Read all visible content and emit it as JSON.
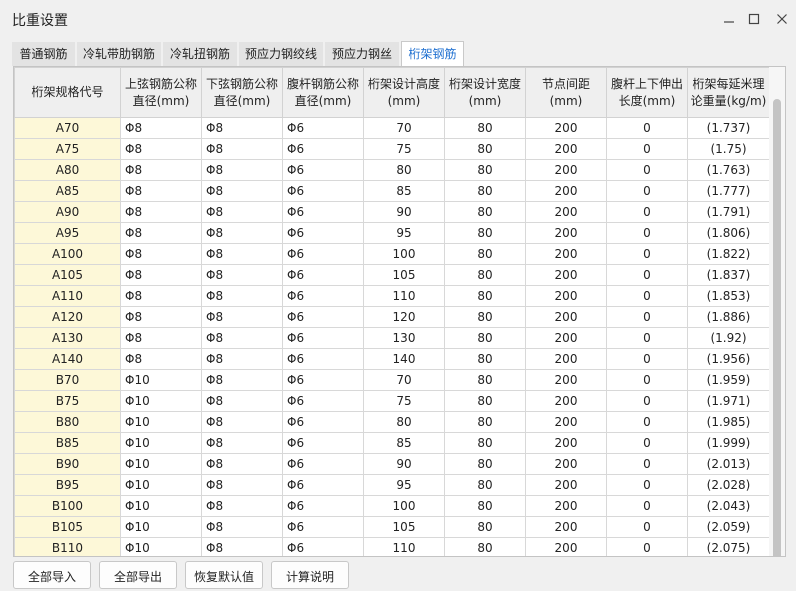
{
  "window": {
    "title": "比重设置"
  },
  "tabs": [
    "普通钢筋",
    "冷轧带肋钢筋",
    "冷轧扭钢筋",
    "预应力钢绞线",
    "预应力钢丝",
    "桁架钢筋"
  ],
  "active_tab": 5,
  "table": {
    "headers": [
      "桁架规格代号",
      "上弦钢筋公称直径(mm)",
      "下弦钢筋公称直径(mm)",
      "腹杆钢筋公称直径(mm)",
      "桁架设计高度(mm)",
      "桁架设计宽度(mm)",
      "节点间距(mm)",
      "腹杆上下伸出长度(mm)",
      "桁架每延米理论重量(kg/m)"
    ],
    "rows": [
      [
        "A70",
        "Φ8",
        "Φ8",
        "Φ6",
        "70",
        "80",
        "200",
        "0",
        "(1.737)"
      ],
      [
        "A75",
        "Φ8",
        "Φ8",
        "Φ6",
        "75",
        "80",
        "200",
        "0",
        "(1.75)"
      ],
      [
        "A80",
        "Φ8",
        "Φ8",
        "Φ6",
        "80",
        "80",
        "200",
        "0",
        "(1.763)"
      ],
      [
        "A85",
        "Φ8",
        "Φ8",
        "Φ6",
        "85",
        "80",
        "200",
        "0",
        "(1.777)"
      ],
      [
        "A90",
        "Φ8",
        "Φ8",
        "Φ6",
        "90",
        "80",
        "200",
        "0",
        "(1.791)"
      ],
      [
        "A95",
        "Φ8",
        "Φ8",
        "Φ6",
        "95",
        "80",
        "200",
        "0",
        "(1.806)"
      ],
      [
        "A100",
        "Φ8",
        "Φ8",
        "Φ6",
        "100",
        "80",
        "200",
        "0",
        "(1.822)"
      ],
      [
        "A105",
        "Φ8",
        "Φ8",
        "Φ6",
        "105",
        "80",
        "200",
        "0",
        "(1.837)"
      ],
      [
        "A110",
        "Φ8",
        "Φ8",
        "Φ6",
        "110",
        "80",
        "200",
        "0",
        "(1.853)"
      ],
      [
        "A120",
        "Φ8",
        "Φ8",
        "Φ6",
        "120",
        "80",
        "200",
        "0",
        "(1.886)"
      ],
      [
        "A130",
        "Φ8",
        "Φ8",
        "Φ6",
        "130",
        "80",
        "200",
        "0",
        "(1.92)"
      ],
      [
        "A140",
        "Φ8",
        "Φ8",
        "Φ6",
        "140",
        "80",
        "200",
        "0",
        "(1.956)"
      ],
      [
        "B70",
        "Φ10",
        "Φ8",
        "Φ6",
        "70",
        "80",
        "200",
        "0",
        "(1.959)"
      ],
      [
        "B75",
        "Φ10",
        "Φ8",
        "Φ6",
        "75",
        "80",
        "200",
        "0",
        "(1.971)"
      ],
      [
        "B80",
        "Φ10",
        "Φ8",
        "Φ6",
        "80",
        "80",
        "200",
        "0",
        "(1.985)"
      ],
      [
        "B85",
        "Φ10",
        "Φ8",
        "Φ6",
        "85",
        "80",
        "200",
        "0",
        "(1.999)"
      ],
      [
        "B90",
        "Φ10",
        "Φ8",
        "Φ6",
        "90",
        "80",
        "200",
        "0",
        "(2.013)"
      ],
      [
        "B95",
        "Φ10",
        "Φ8",
        "Φ6",
        "95",
        "80",
        "200",
        "0",
        "(2.028)"
      ],
      [
        "B100",
        "Φ10",
        "Φ8",
        "Φ6",
        "100",
        "80",
        "200",
        "0",
        "(2.043)"
      ],
      [
        "B105",
        "Φ10",
        "Φ8",
        "Φ6",
        "105",
        "80",
        "200",
        "0",
        "(2.059)"
      ],
      [
        "B110",
        "Φ10",
        "Φ8",
        "Φ6",
        "110",
        "80",
        "200",
        "0",
        "(2.075)"
      ]
    ]
  },
  "buttons": [
    "全部导入",
    "全部导出",
    "恢复默认值",
    "计算说明"
  ],
  "colors": {
    "active_tab_text": "#1e6fd0",
    "code_cell_bg": "#fdf8d8"
  }
}
